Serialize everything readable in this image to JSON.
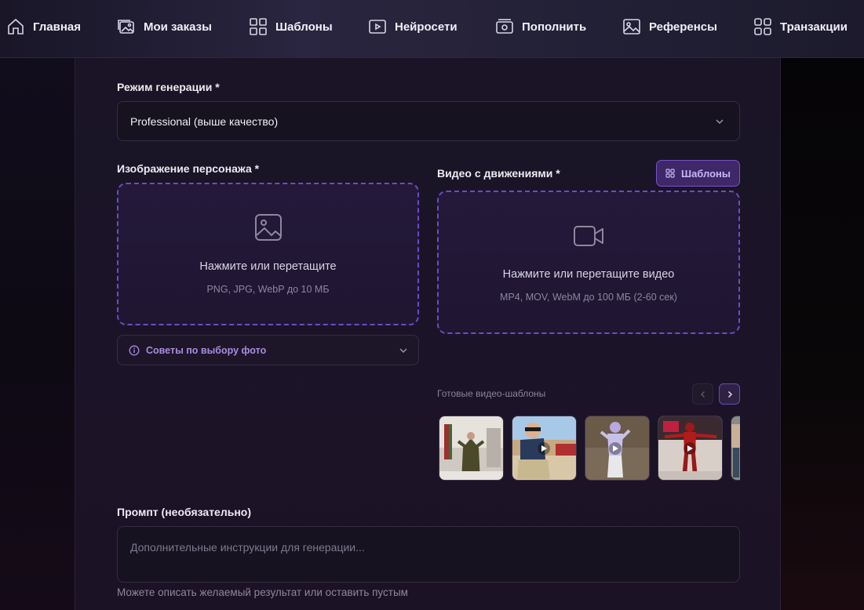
{
  "nav": {
    "items": [
      {
        "label": "Главная",
        "icon": "home-icon"
      },
      {
        "label": "Мои заказы",
        "icon": "images-icon"
      },
      {
        "label": "Шаблоны",
        "icon": "grid-icon"
      },
      {
        "label": "Нейросети",
        "icon": "play-icon"
      },
      {
        "label": "Пополнить",
        "icon": "wallet-icon"
      },
      {
        "label": "Референсы",
        "icon": "image-icon"
      },
      {
        "label": "Транзакции",
        "icon": "apps-icon"
      }
    ]
  },
  "form": {
    "mode_label": "Режим генерации *",
    "mode_value": "Professional (выше качество)",
    "image_label": "Изображение персонажа *",
    "image_drop_title": "Нажмите или перетащите",
    "image_drop_sub": "PNG, JPG, WebP до 10 МБ",
    "tips_label": "Советы по выбору фото",
    "video_label": "Видео с движениями *",
    "templates_button": "Шаблоны",
    "video_drop_title": "Нажмите или перетащите видео",
    "video_drop_sub": "MP4, MOV, WebM до 100 МБ (2-60 сек)",
    "ready_templates_label": "Готовые видео-шаблоны",
    "prompt_label": "Промпт (необязательно)",
    "prompt_placeholder": "Дополнительные инструкции для генерации...",
    "prompt_hint": "Можете описать желаемый результат или оставить пустым"
  },
  "colors": {
    "accent": "#7a52c8",
    "accent_text": "#a78bdf",
    "panel_bg": "#1a1426",
    "field_bg": "#17121f"
  }
}
